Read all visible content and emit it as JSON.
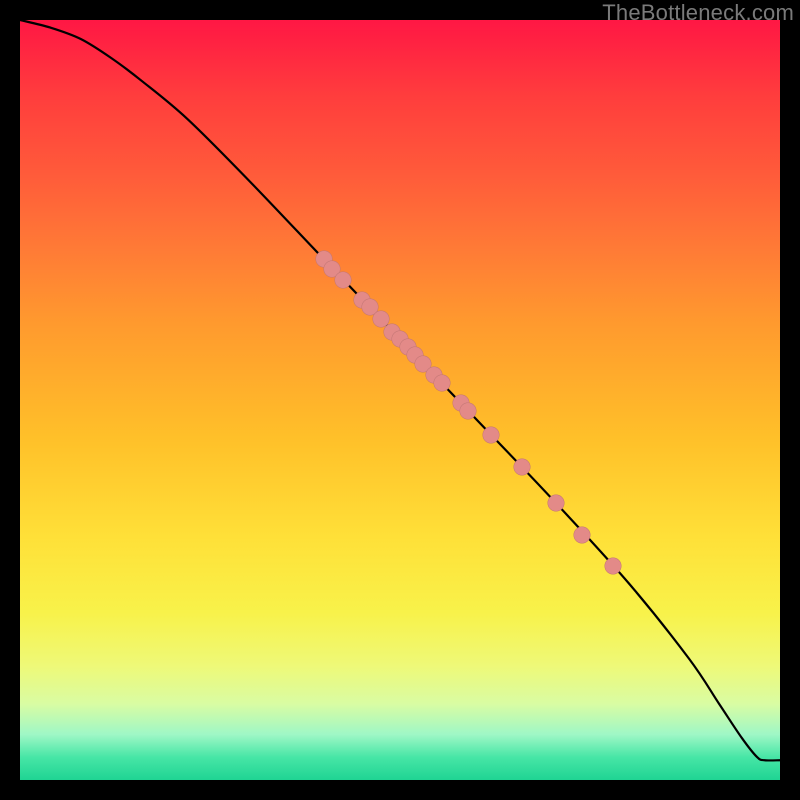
{
  "watermark": "TheBottleneck.com",
  "colors": {
    "marker": "#e38a88",
    "line": "#000000",
    "frame_bg": "#000000"
  },
  "chart_data": {
    "type": "line",
    "title": "",
    "xlabel": "",
    "ylabel": "",
    "xlim": [
      0,
      100
    ],
    "ylim": [
      0,
      100
    ],
    "grid": false,
    "legend": false,
    "description": "Single monotone curve from top-left to bottom-right over vertical red→yellow→green gradient, with scatter markers clustered mid-curve.",
    "curve": {
      "x": [
        0,
        4,
        8,
        12,
        16,
        22,
        30,
        40,
        50,
        60,
        70,
        80,
        88,
        92,
        95,
        97,
        98,
        100
      ],
      "y": [
        100,
        99,
        97.5,
        95,
        92,
        87,
        79,
        68.5,
        58,
        47.5,
        37,
        26,
        16,
        10,
        5.5,
        3,
        2.6,
        2.6
      ]
    },
    "markers": [
      {
        "x": 40.0,
        "y": 68.5
      },
      {
        "x": 41.0,
        "y": 67.3
      },
      {
        "x": 42.5,
        "y": 65.8
      },
      {
        "x": 45.0,
        "y": 63.2
      },
      {
        "x": 46.0,
        "y": 62.2
      },
      {
        "x": 47.5,
        "y": 60.6
      },
      {
        "x": 49.0,
        "y": 59.0
      },
      {
        "x": 50.0,
        "y": 58.0
      },
      {
        "x": 51.0,
        "y": 57.0
      },
      {
        "x": 52.0,
        "y": 55.9
      },
      {
        "x": 53.0,
        "y": 54.8
      },
      {
        "x": 54.5,
        "y": 53.3
      },
      {
        "x": 55.5,
        "y": 52.2
      },
      {
        "x": 58.0,
        "y": 49.6
      },
      {
        "x": 59.0,
        "y": 48.5
      },
      {
        "x": 62.0,
        "y": 45.4
      },
      {
        "x": 66.0,
        "y": 41.2
      },
      {
        "x": 70.5,
        "y": 36.5
      },
      {
        "x": 74.0,
        "y": 32.3
      },
      {
        "x": 78.0,
        "y": 28.1
      }
    ]
  }
}
